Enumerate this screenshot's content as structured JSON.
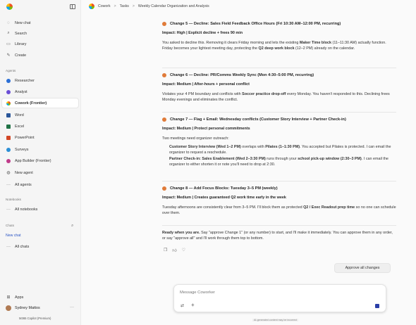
{
  "sidebar": {
    "top_items": [
      {
        "label": "New chat",
        "icon": "chat-icon"
      },
      {
        "label": "Search",
        "icon": "search-icon"
      },
      {
        "label": "Library",
        "icon": "library-icon"
      },
      {
        "label": "Create",
        "icon": "create-icon"
      }
    ],
    "agents_label": "Agents",
    "agents": [
      {
        "label": "Researcher",
        "icon": "researcher-icon",
        "color": "#2b6fd6"
      },
      {
        "label": "Analyst",
        "icon": "analyst-icon",
        "color": "#6b4fd6"
      },
      {
        "label": "Cowork (Frontier)",
        "icon": "cowork-icon",
        "color": "#e25a2b",
        "active": true
      },
      {
        "label": "Word",
        "icon": "word-icon",
        "color": "#2b579a"
      },
      {
        "label": "Excel",
        "icon": "excel-icon",
        "color": "#217346"
      },
      {
        "label": "PowerPoint",
        "icon": "powerpoint-icon",
        "color": "#d24726"
      },
      {
        "label": "Surveys",
        "icon": "surveys-icon",
        "color": "#2b8fd6"
      },
      {
        "label": "App Builder (Frontier)",
        "icon": "app-builder-icon",
        "color": "#c03b8a"
      },
      {
        "label": "New agent",
        "icon": "new-agent-icon",
        "color": "#555555"
      },
      {
        "label": "All agents",
        "icon": "more-icon",
        "color": "#555555"
      }
    ],
    "notebooks_label": "Notebooks",
    "all_notebooks": "All notebooks",
    "chats_label": "Chats",
    "new_chat_link": "New chat",
    "all_chats": "All chats",
    "apps": "Apps",
    "user_name": "Sydney Mattos",
    "user_more": "···",
    "plan": "M365 Copilot (Premium)"
  },
  "header": {
    "crumbs": [
      "Cowork",
      "Tasks",
      "Weekly Calendar Organization and Analysis"
    ],
    "separator": ">"
  },
  "changes": [
    {
      "title": "Change 5 — Decline: Sales Field Feedback Office Hours (Fri 10:30 AM–12:00 PM, recurring)",
      "impact": "Impact: High | Explicit decline + frees 90 min",
      "desc_parts": [
        "You asked to decline this. Removing it clears Friday morning and lets the existing ",
        "Maker Time block",
        " (11–11:30 AM) actually function. Friday becomes your lightest meeting day, protecting the ",
        "Q2 deep work block",
        " (12–2 PM) already on the calendar."
      ]
    },
    {
      "title": "Change 6 — Decline: PR/Comms Weekly Sync (Mon 4:30–5:00 PM, recurring)",
      "impact": "Impact: Medium | After-hours + personal conflict",
      "desc_parts": [
        "Violates your 4 PM boundary and conflicts with ",
        "Soccer practice drop-off",
        " every Monday. You haven't responded to this. Declining frees Monday evenings and eliminates the conflict."
      ]
    },
    {
      "title": "Change 7 — Flag + Email: Wednesday conflicts (Customer Story Interview + Partner Check-in)",
      "impact": "Impact: Medium | Protect personal commitments",
      "intro": "Two meetings need organizer outreach:",
      "item1_parts": [
        "Customer Story Interview (Wed 1–2 PM)",
        " overlaps with ",
        "Pilates (1–1:30 PM)",
        ". You accepted but Pilates is protected. I can email the organizer to request a reschedule."
      ],
      "item2_parts": [
        "Partner Check-in: Sales Enablement (Wed 2–3:30 PM)",
        " runs through your ",
        "school pick-up window (2:30–3 PM)",
        ". I can email the organizer to either shorten it or note you'll need to drop at 2:30."
      ]
    },
    {
      "title": "Change 8 — Add Focus Blocks: Tuesday 3–5 PM (weekly)",
      "impact": "Impact: Medium | Creates guaranteed Q2 work time early in the week",
      "desc_parts": [
        "Tuesday afternoons are consistently clear from 3–5 PM. I'll block them as protected ",
        "Q2 / Exec Readout prep time",
        " so no one can schedule over them."
      ]
    }
  ],
  "ready_parts": [
    "Ready when you are.",
    " Say \"approve Change 1\" (or any number) to start, and I'll make it immediately. You can approve them in any order, or say \"approve all\" and I'll work through them top to bottom."
  ],
  "approve_all": "Approve all changes",
  "composer": {
    "placeholder": "Message Coworker",
    "tools_icon": "⇄",
    "add_icon": "+"
  },
  "disclaimer": "AI-generated content may be incorrect",
  "colors": {
    "accent": "#2b3fa8",
    "change_dot": "#e07b39"
  }
}
